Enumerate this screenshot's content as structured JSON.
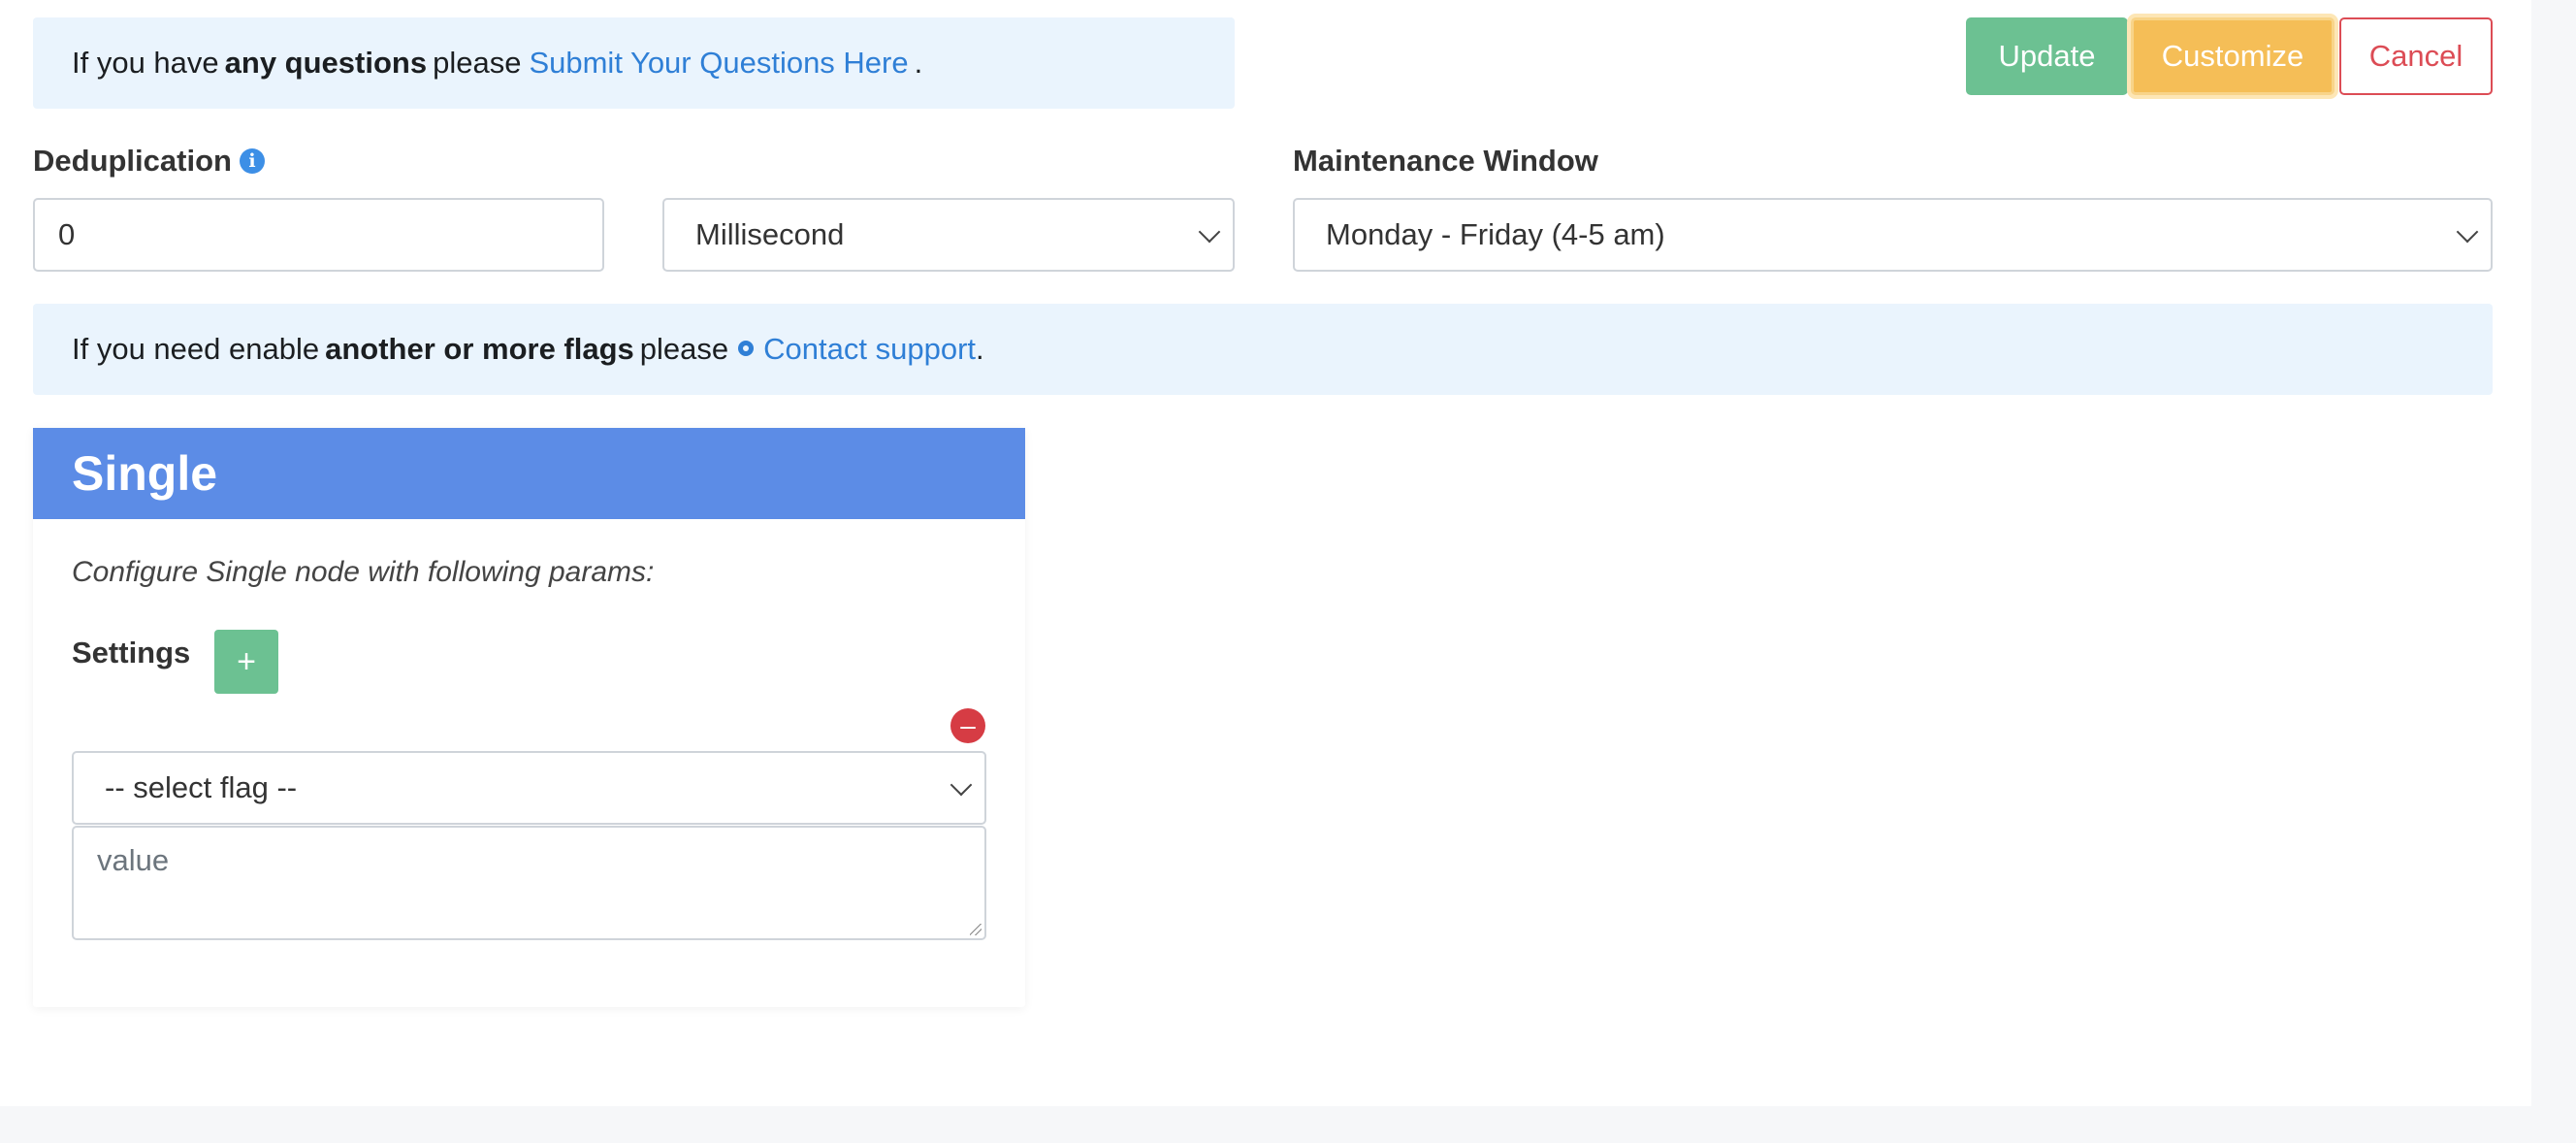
{
  "alert_questions": {
    "prefix": "If you have",
    "bold": "any questions",
    "middle": "please",
    "link": "Submit Your Questions Here",
    "suffix": "."
  },
  "buttons": {
    "update": "Update",
    "customize": "Customize",
    "cancel": "Cancel"
  },
  "dedup": {
    "label": "Deduplication",
    "info_icon": "info-icon",
    "value": "0",
    "unit": "Millisecond"
  },
  "maintenance": {
    "label": "Maintenance Window",
    "value": "Monday - Friday (4-5 am)"
  },
  "alert_flags": {
    "prefix": "If you need enable",
    "bold": "another or more flags",
    "middle": "please",
    "link_icon": "cog-icon",
    "link": "Contact support",
    "suffix": "."
  },
  "card": {
    "title": "Single",
    "description": "Configure Single node with following params:",
    "settings_label": "Settings",
    "add_symbol": "+",
    "remove_symbol": "–",
    "flag_select": "-- select flag --",
    "value_placeholder": "value"
  },
  "colors": {
    "update": "#6cc192",
    "customize": "#f5be57",
    "cancel": "#dc4c55",
    "card_header": "#5c8ce6",
    "alert_bg": "#eaf4fd",
    "link": "#2f7fd6"
  }
}
